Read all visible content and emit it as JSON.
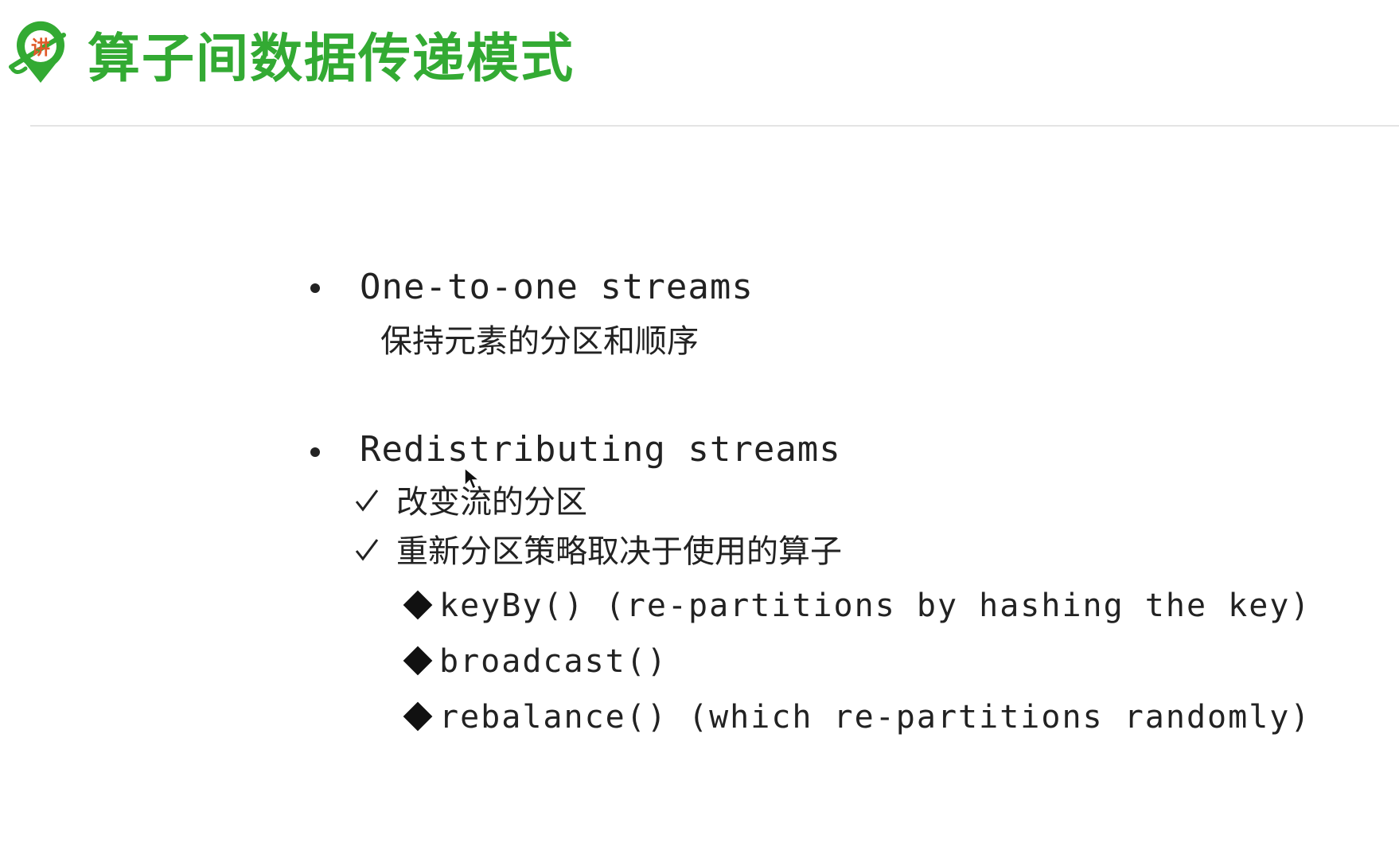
{
  "title": "算子间数据传递模式",
  "logo": {
    "text": "讲",
    "color": "#33aa33"
  },
  "sections": [
    {
      "heading": "One-to-one streams",
      "description": "保持元素的分区和顺序"
    },
    {
      "heading": "Redistributing streams",
      "checks": [
        "改变流的分区",
        "重新分区策略取决于使用的算子"
      ],
      "methods": [
        "keyBy() (re-partitions by hashing the key)",
        "broadcast()",
        "rebalance() (which re-partitions randomly)"
      ]
    }
  ]
}
